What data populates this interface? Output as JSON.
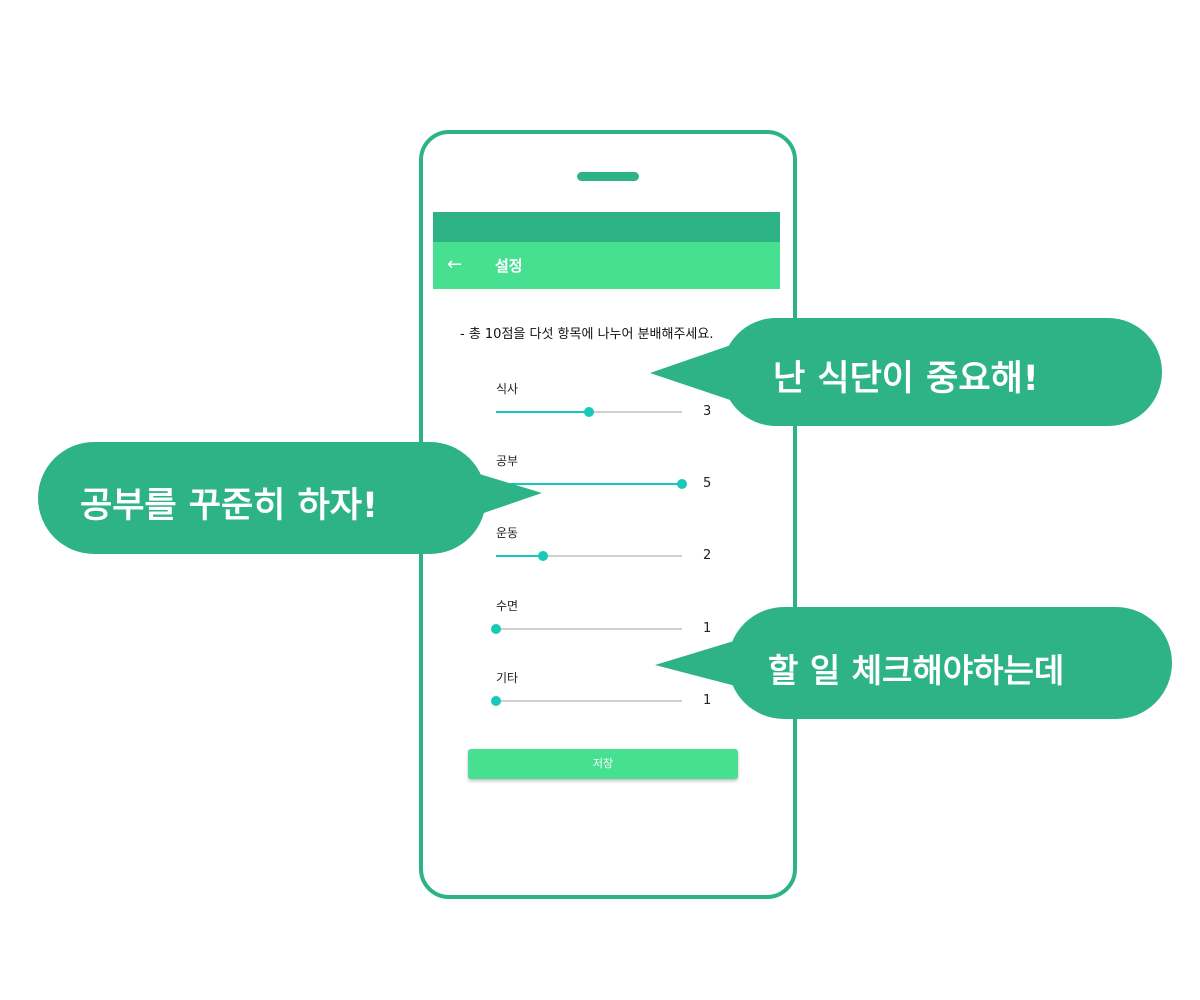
{
  "app_bar": {
    "title": "설정",
    "back_icon": "arrow-left-icon"
  },
  "instruction": "- 총 10점을 다섯 항목에 나누어 분배해주세요.",
  "sliders": [
    {
      "label": "식사",
      "value": 3,
      "max": 5
    },
    {
      "label": "공부",
      "value": 5,
      "max": 5
    },
    {
      "label": "운동",
      "value": 2,
      "max": 5
    },
    {
      "label": "수면",
      "value": 1,
      "max": 5
    },
    {
      "label": "기타",
      "value": 1,
      "max": 5
    }
  ],
  "save_label": "저장",
  "bubbles": {
    "top_right": "난 식단이 중요해!",
    "left": "공부를 꾸준히 하자!",
    "bottom_right": "할 일 체크해야하는데"
  },
  "colors": {
    "brand_dark": "#2db386",
    "brand_light": "#46e090",
    "slider": "#17c9b8"
  }
}
